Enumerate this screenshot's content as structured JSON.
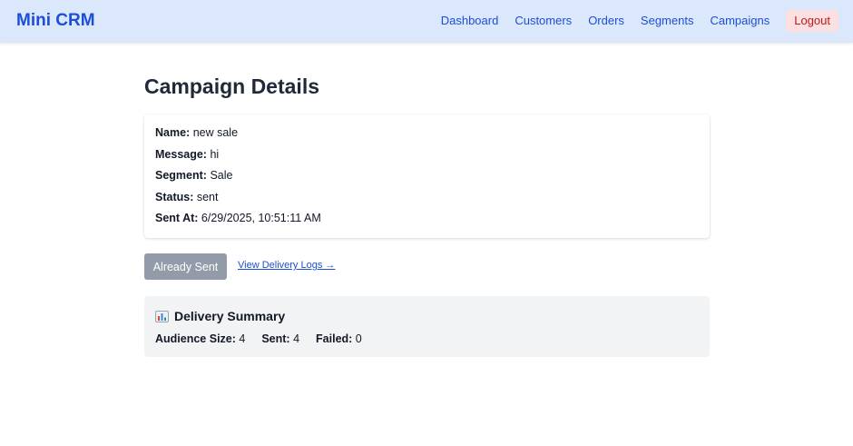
{
  "nav": {
    "brand": "Mini CRM",
    "links": [
      "Dashboard",
      "Customers",
      "Orders",
      "Segments",
      "Campaigns"
    ],
    "logout": "Logout"
  },
  "page": {
    "title": "Campaign Details"
  },
  "details": {
    "name_label": "Name:",
    "name": "new sale",
    "message_label": "Message:",
    "message": "hi",
    "segment_label": "Segment:",
    "segment": "Sale",
    "status_label": "Status:",
    "status": "sent",
    "sent_at_label": "Sent At:",
    "sent_at": "6/29/2025, 10:51:11 AM"
  },
  "actions": {
    "already_sent": "Already Sent",
    "view_logs": "View Delivery Logs →"
  },
  "summary": {
    "icon": "bar-chart-icon",
    "title": "Delivery Summary",
    "audience_label": "Audience Size:",
    "audience": "4",
    "sent_label": "Sent:",
    "sent": "4",
    "failed_label": "Failed:",
    "failed": "0"
  }
}
